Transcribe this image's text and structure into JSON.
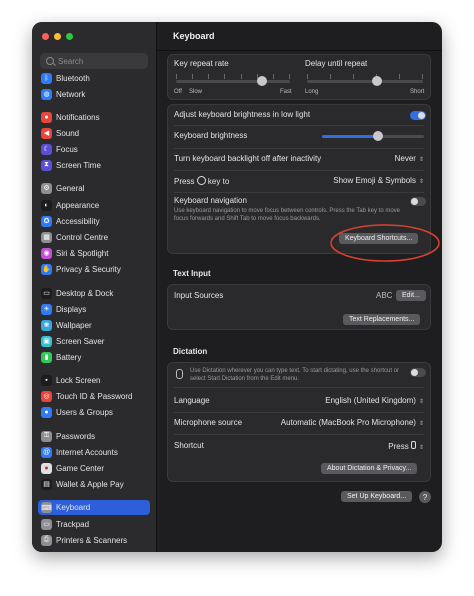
{
  "window": {
    "title": "Keyboard"
  },
  "traffic_lights": [
    "#ff5f57",
    "#febc2e",
    "#28c840"
  ],
  "search": {
    "placeholder": "Search"
  },
  "sidebar": {
    "items": [
      {
        "label": "Bluetooth",
        "icon": "bluetooth-icon",
        "color": "#2f7bf5"
      },
      {
        "label": "Network",
        "icon": "network-icon",
        "color": "#2f7bf5"
      },
      {
        "label": "Notifications",
        "icon": "bell-icon",
        "color": "#e8453c"
      },
      {
        "label": "Sound",
        "icon": "speaker-icon",
        "color": "#e8453c"
      },
      {
        "label": "Focus",
        "icon": "moon-icon",
        "color": "#5b4fd6"
      },
      {
        "label": "Screen Time",
        "icon": "hourglass-icon",
        "color": "#5b4fd6"
      },
      {
        "label": "General",
        "icon": "gear-icon",
        "color": "#8e8e93"
      },
      {
        "label": "Appearance",
        "icon": "appearance-icon",
        "color": "#1c1c1e"
      },
      {
        "label": "Accessibility",
        "icon": "accessibility-icon",
        "color": "#2f7bf5"
      },
      {
        "label": "Control Centre",
        "icon": "control-centre-icon",
        "color": "#8e8e93"
      },
      {
        "label": "Siri & Spotlight",
        "icon": "siri-icon",
        "color": "#c54fd6"
      },
      {
        "label": "Privacy & Security",
        "icon": "hand-icon",
        "color": "#2f7bf5"
      },
      {
        "label": "Desktop & Dock",
        "icon": "dock-icon",
        "color": "#1c1c1e"
      },
      {
        "label": "Displays",
        "icon": "display-icon",
        "color": "#2f7bf5"
      },
      {
        "label": "Wallpaper",
        "icon": "wallpaper-icon",
        "color": "#35a8e0"
      },
      {
        "label": "Screen Saver",
        "icon": "screen-saver-icon",
        "color": "#35c0d0"
      },
      {
        "label": "Battery",
        "icon": "battery-icon",
        "color": "#34c759"
      },
      {
        "label": "Lock Screen",
        "icon": "lock-icon",
        "color": "#1c1c1e"
      },
      {
        "label": "Touch ID & Password",
        "icon": "fingerprint-icon",
        "color": "#e8453c"
      },
      {
        "label": "Users & Groups",
        "icon": "users-icon",
        "color": "#2f7bf5"
      },
      {
        "label": "Passwords",
        "icon": "key-icon",
        "color": "#8e8e93"
      },
      {
        "label": "Internet Accounts",
        "icon": "at-icon",
        "color": "#2f7bf5"
      },
      {
        "label": "Game Center",
        "icon": "game-center-icon",
        "color": "#e0e0e0"
      },
      {
        "label": "Wallet & Apple Pay",
        "icon": "wallet-icon",
        "color": "#1c1c1e"
      },
      {
        "label": "Keyboard",
        "icon": "keyboard-icon",
        "color": "#8e8e93",
        "selected": true
      },
      {
        "label": "Trackpad",
        "icon": "trackpad-icon",
        "color": "#8e8e93"
      },
      {
        "label": "Printers & Scanners",
        "icon": "printer-icon",
        "color": "#8e8e93"
      }
    ]
  },
  "repeat": {
    "rate_label": "Key repeat rate",
    "rate_min": "Off",
    "rate_slow": "Slow",
    "rate_max": "Fast",
    "rate_level": 0.75,
    "delay_label": "Delay until repeat",
    "delay_min": "Long",
    "delay_max": "Short",
    "delay_level": 0.6
  },
  "backlight": {
    "adjust_label": "Adjust keyboard brightness in low light",
    "adjust_on": true,
    "brightness_label": "Keyboard brightness",
    "brightness_level": 0.55,
    "off_label": "Turn keyboard backlight off after inactivity",
    "off_value": "Never",
    "press_prefix": "Press",
    "press_suffix": "key to",
    "press_value": "Show Emoji & Symbols",
    "nav_label": "Keyboard navigation",
    "nav_desc": "Use keyboard navigation to move focus between controls. Press the Tab key to move focus forwards and Shift Tab to move focus backwards.",
    "nav_on": false,
    "shortcuts_button": "Keyboard Shortcuts..."
  },
  "text_input": {
    "heading": "Text Input",
    "sources_label": "Input Sources",
    "sources_value": "ABC",
    "edit_button": "Edit...",
    "replacements_button": "Text Replacements..."
  },
  "dictation": {
    "heading": "Dictation",
    "desc": "Use Dictation wherever you can type text. To start dictating, use the shortcut or select Start Dictation from the Edit menu.",
    "enabled": false,
    "language_label": "Language",
    "language_value": "English (United Kingdom)",
    "mic_label": "Microphone source",
    "mic_value": "Automatic (MacBook Pro Microphone)",
    "shortcut_label": "Shortcut",
    "shortcut_value": "Press",
    "about_button": "About Dictation & Privacy..."
  },
  "footer": {
    "setup_button": "Set Up Keyboard...",
    "help_button": "?"
  },
  "highlight_color": "#d9412f"
}
